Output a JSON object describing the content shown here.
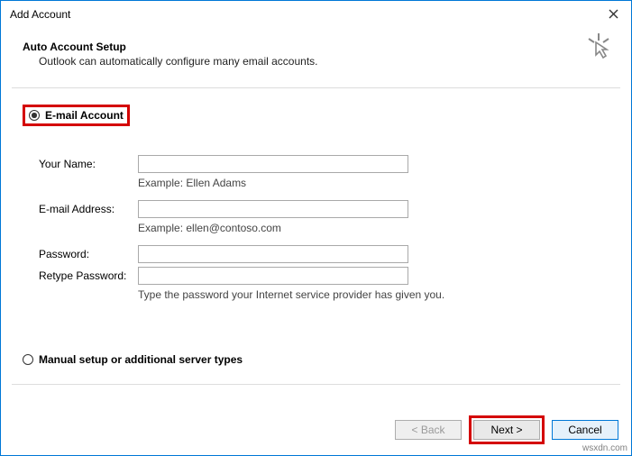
{
  "window": {
    "title": "Add Account"
  },
  "header": {
    "title": "Auto Account Setup",
    "subtitle": "Outlook can automatically configure many email accounts."
  },
  "options": {
    "email_account_label": "E-mail Account",
    "manual_setup_label": "Manual setup or additional server types"
  },
  "form": {
    "name_label": "Your Name:",
    "name_value": "",
    "name_hint": "Example: Ellen Adams",
    "email_label": "E-mail Address:",
    "email_value": "",
    "email_hint": "Example: ellen@contoso.com",
    "password_label": "Password:",
    "password_value": "",
    "retype_label": "Retype Password:",
    "retype_value": "",
    "password_hint": "Type the password your Internet service provider has given you."
  },
  "buttons": {
    "back": "< Back",
    "next": "Next >",
    "cancel": "Cancel"
  },
  "watermark": "wsxdn.com"
}
